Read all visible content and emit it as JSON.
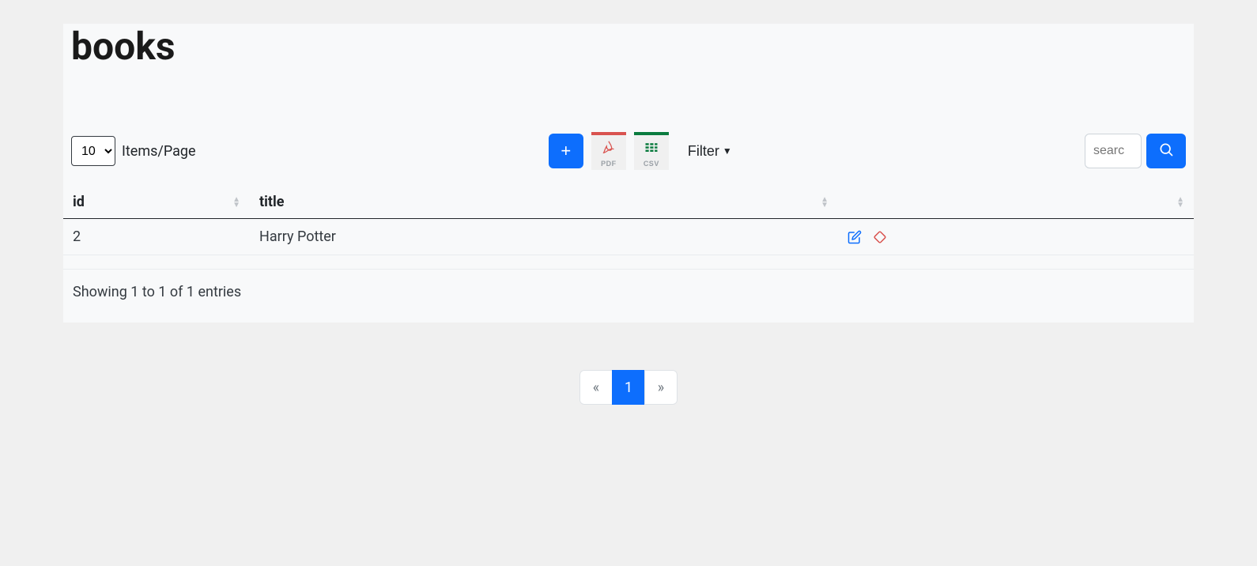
{
  "page": {
    "title": "books"
  },
  "toolbar": {
    "items_per_page_value": "10",
    "items_per_page_label": "Items/Page",
    "add_label": "+",
    "pdf_label": "PDF",
    "csv_label": "CSV",
    "filter_label": "Filter",
    "search_placeholder": "searc"
  },
  "table": {
    "columns": {
      "id": "id",
      "title": "title"
    },
    "rows": [
      {
        "id": "2",
        "title": "Harry Potter"
      }
    ]
  },
  "footer": {
    "showing_text": "Showing 1 to 1 of 1 entries"
  },
  "pagination": {
    "prev": "«",
    "next": "»",
    "current": "1"
  },
  "icons": {
    "edit": "edit-icon",
    "delete": "eraser-icon",
    "search": "search-icon",
    "pdf": "pdf-icon",
    "csv": "csv-icon",
    "caret": "caret-down-icon"
  },
  "colors": {
    "primary": "#0d6efd",
    "danger": "#d9534f",
    "success": "#0a7b3e"
  }
}
